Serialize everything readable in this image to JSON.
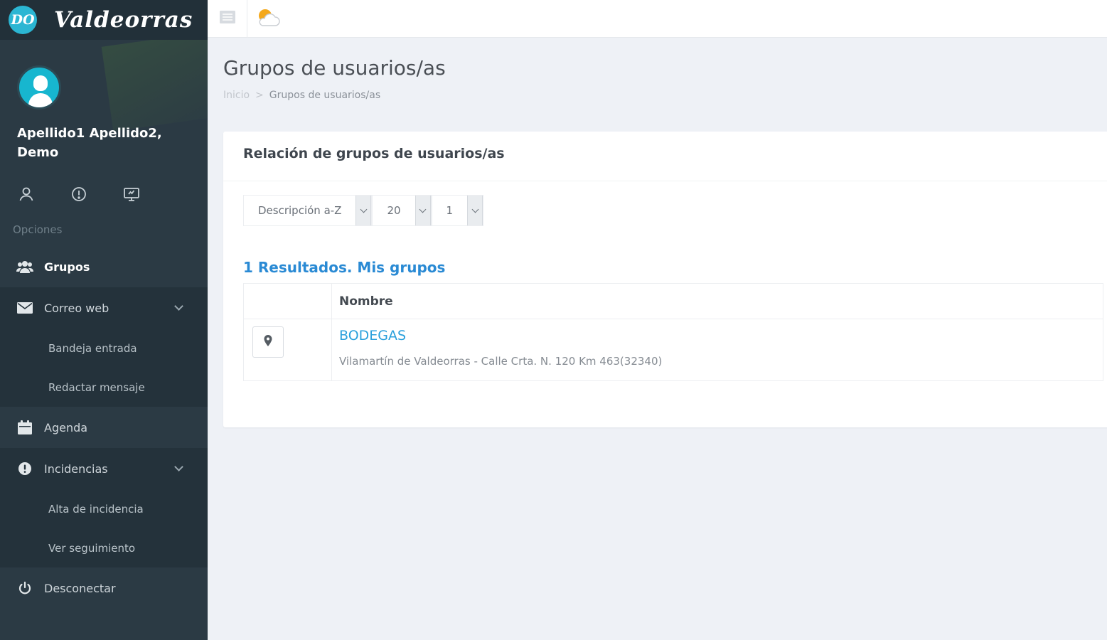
{
  "brand": {
    "logo_text": "DO",
    "name": "Valdeorras"
  },
  "user": {
    "name": "Apellido1 Apellido2, Demo"
  },
  "profile_icons": [
    "user-icon",
    "info-icon",
    "screen-icon"
  ],
  "sidebar": {
    "section_label": "Opciones",
    "items": [
      {
        "label": "Grupos",
        "icon": "users-icon"
      },
      {
        "label": "Correo web",
        "icon": "envelope-icon"
      },
      {
        "label": "Bandeja entrada"
      },
      {
        "label": "Redactar mensaje"
      },
      {
        "label": "Agenda",
        "icon": "calendar-icon"
      },
      {
        "label": "Incidencias",
        "icon": "alert-icon"
      },
      {
        "label": "Alta de incidencia"
      },
      {
        "label": "Ver seguimiento"
      },
      {
        "label": "Desconectar",
        "icon": "power-icon"
      }
    ]
  },
  "topbar": {
    "menu_icon": "menu-icon",
    "weather_icon": "weather-icon"
  },
  "page": {
    "title": "Grupos de usuarios/as",
    "breadcrumb": {
      "home": "Inicio",
      "separator": ">",
      "current": "Grupos de usuarios/as"
    }
  },
  "panel": {
    "title": "Relación de grupos de usuarios/as",
    "filters": {
      "sort": "Descripción a-Z",
      "per_page": "20",
      "page": "1"
    },
    "results_title": "1 Resultados. Mis grupos",
    "table": {
      "column_name": "Nombre",
      "rows": [
        {
          "name": "BODEGAS",
          "address": "Vilamartín de Valdeorras - Calle Crta. N. 120 Km 463(32340)"
        }
      ]
    }
  },
  "colors": {
    "sidebar": "#2b3a44",
    "accent": "#2a8ad4",
    "link": "#2aa0dc",
    "avatar": "#17b6cf"
  }
}
